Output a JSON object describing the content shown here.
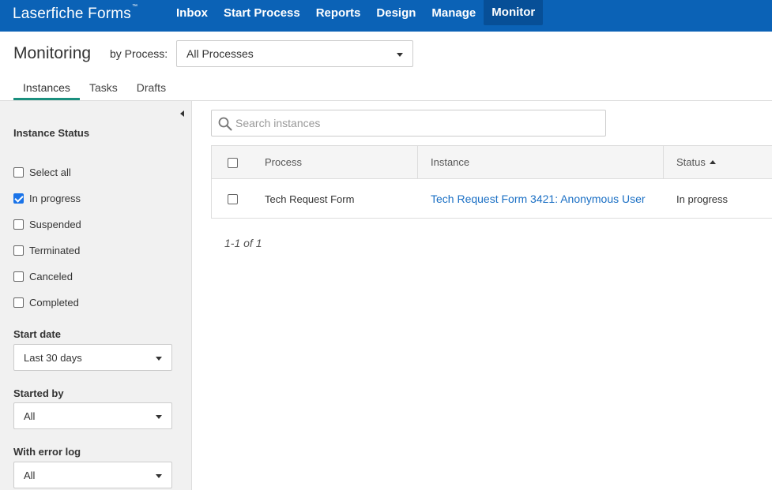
{
  "app": {
    "brand": "Laserfiche Forms",
    "tm": "™"
  },
  "nav": [
    {
      "label": "Inbox"
    },
    {
      "label": "Start Process"
    },
    {
      "label": "Reports"
    },
    {
      "label": "Design"
    },
    {
      "label": "Manage"
    },
    {
      "label": "Monitor",
      "active": true
    }
  ],
  "header": {
    "title": "Monitoring",
    "by_process_label": "by Process:",
    "process_select_value": "All Processes"
  },
  "tabs": [
    {
      "label": "Instances",
      "active": true
    },
    {
      "label": "Tasks"
    },
    {
      "label": "Drafts"
    }
  ],
  "sidebar": {
    "instance_status_title": "Instance Status",
    "statuses": [
      {
        "label": "Select all",
        "checked": false
      },
      {
        "label": "In progress",
        "checked": true
      },
      {
        "label": "Suspended",
        "checked": false
      },
      {
        "label": "Terminated",
        "checked": false
      },
      {
        "label": "Canceled",
        "checked": false
      },
      {
        "label": "Completed",
        "checked": false
      }
    ],
    "start_date_label": "Start date",
    "start_date_value": "Last 30 days",
    "started_by_label": "Started by",
    "started_by_value": "All",
    "error_log_label": "With error log",
    "error_log_value": "All"
  },
  "search": {
    "placeholder": "Search instances",
    "value": ""
  },
  "grid": {
    "columns": [
      "Process",
      "Instance",
      "Status"
    ],
    "rows": [
      {
        "process": "Tech Request Form",
        "instance": "Tech Request Form 3421: Anonymous User",
        "status": "In progress"
      }
    ]
  },
  "pager": {
    "text": "1-1 of 1"
  },
  "colors": {
    "topbar": "#0b62b6",
    "tab_active_underline": "#1a8f7e",
    "link": "#1a6fc4"
  }
}
